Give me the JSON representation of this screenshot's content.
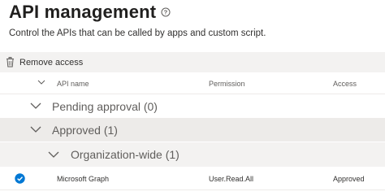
{
  "header": {
    "title": "API management",
    "description": "Control the APIs that can be called by apps and custom script."
  },
  "toolbar": {
    "remove_label": "Remove access"
  },
  "table": {
    "columns": [
      "API name",
      "Permission",
      "Access"
    ],
    "groups": [
      {
        "label": "Pending approval (0)"
      },
      {
        "label": "Approved (1)"
      },
      {
        "label": "Organization-wide (1)"
      }
    ],
    "rows": [
      {
        "api": "Microsoft Graph",
        "permission": "User.Read.All",
        "access": "Approved"
      }
    ]
  },
  "colors": {
    "accent": "#0078d4",
    "toolbar_bg": "#f3f2f1",
    "group_bg": "#edebe9"
  },
  "icons": [
    "help-icon",
    "trash-icon",
    "chevron-down-icon",
    "checkmark-circle-icon"
  ]
}
